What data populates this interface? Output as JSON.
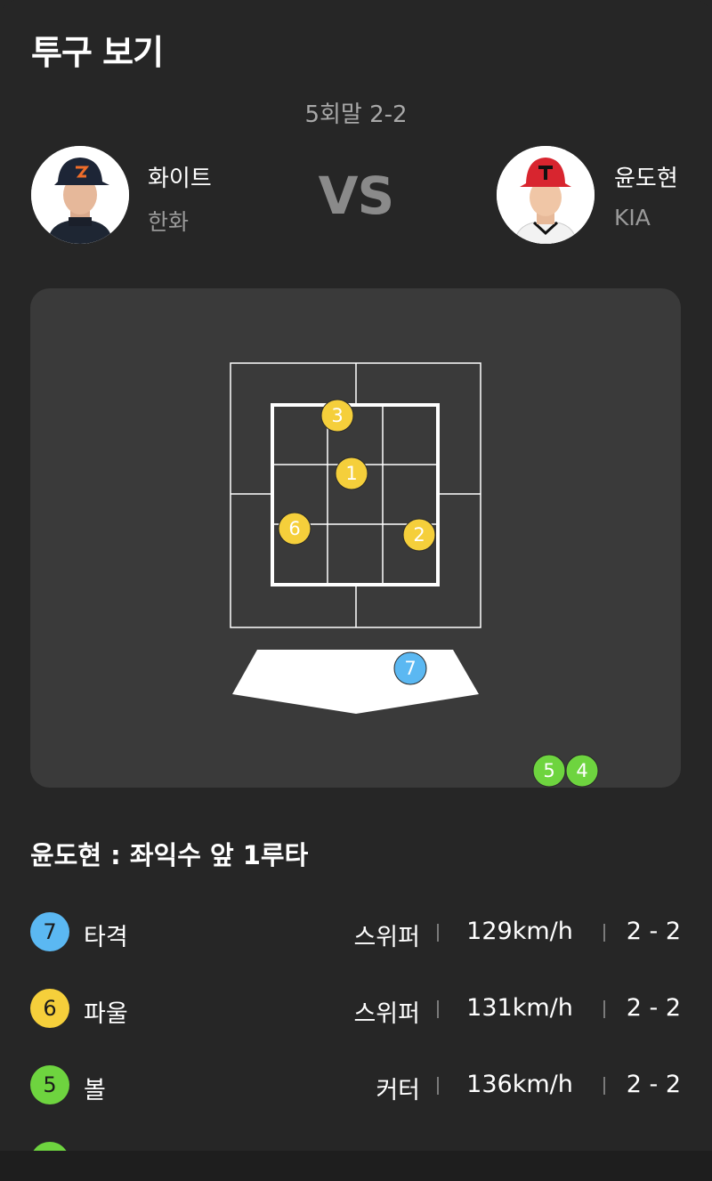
{
  "header": {
    "title": "투구 보기"
  },
  "game": {
    "inning_score": "5회말 2-2"
  },
  "matchup": {
    "pitcher": {
      "name": "화이트",
      "team": "한화"
    },
    "vs": "VS",
    "batter": {
      "name": "윤도현",
      "team": "KIA"
    }
  },
  "zone": {
    "pitch_markers": [
      {
        "label": "1",
        "color": "#f5cf3b"
      },
      {
        "label": "2",
        "color": "#f5cf3b"
      },
      {
        "label": "3",
        "color": "#f5cf3b"
      },
      {
        "label": "4",
        "color": "#6ed43f"
      },
      {
        "label": "5",
        "color": "#6ed43f"
      },
      {
        "label": "6",
        "color": "#f5cf3b"
      },
      {
        "label": "7",
        "color": "#5bb8f2"
      }
    ]
  },
  "result": {
    "text": "윤도현 : 좌익수 앞 1루타"
  },
  "pitches": [
    {
      "num": "7",
      "color": "#5bb8f2",
      "type": "타격",
      "kind": "스위퍼",
      "speed": "129km/h",
      "count": "2 - 2"
    },
    {
      "num": "6",
      "color": "#f5cf3b",
      "type": "파울",
      "kind": "스위퍼",
      "speed": "131km/h",
      "count": "2 - 2"
    },
    {
      "num": "5",
      "color": "#6ed43f",
      "type": "볼",
      "kind": "커터",
      "speed": "136km/h",
      "count": "2 - 2"
    }
  ],
  "colors": {
    "background": "#262626",
    "panel": "#3a3a3a",
    "strike": "#f5cf3b",
    "ball": "#6ed43f",
    "hit": "#5bb8f2"
  }
}
